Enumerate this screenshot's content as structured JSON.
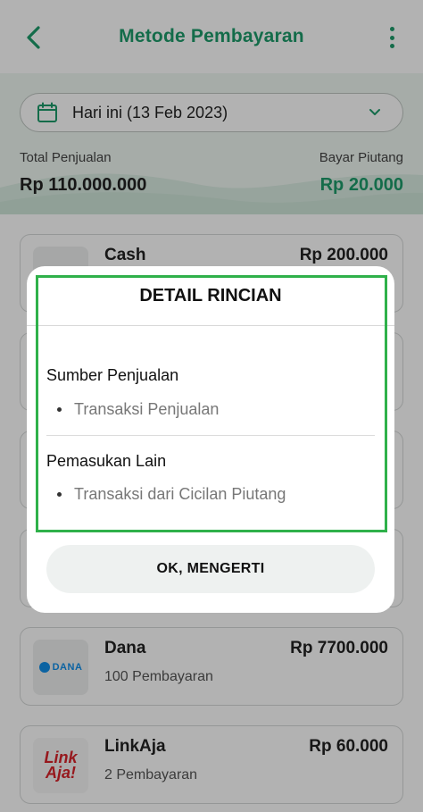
{
  "header": {
    "title": "Metode Pembayaran"
  },
  "summary": {
    "date_label": "Hari ini (13 Feb 2023)",
    "total_label": "Total Penjualan",
    "total_value": "Rp 110.000.000",
    "paid_label": "Bayar Piutang",
    "paid_value": "Rp 20.000"
  },
  "methods": [
    {
      "name": "Cash",
      "amount": "Rp 200.000",
      "count": ""
    },
    {
      "name": "Dana",
      "amount": "Rp 7700.000",
      "count": "100 Pembayaran",
      "logo_text": "DANA"
    },
    {
      "name": "LinkAja",
      "amount": "Rp 60.000",
      "count": "2 Pembayaran",
      "logo_text_1": "Link",
      "logo_text_2": "Aja!"
    }
  ],
  "modal": {
    "title": "DETAIL RINCIAN",
    "sections": [
      {
        "title": "Sumber Penjualan",
        "items": [
          "Transaksi Penjualan"
        ]
      },
      {
        "title": "Pemasukan Lain",
        "items": [
          "Transaksi dari Cicilan Piutang"
        ]
      }
    ],
    "ok_label": "OK, MENGERTI"
  },
  "colors": {
    "brand_green": "#1e9b6b",
    "highlight": "#2fb14a",
    "linkaja_red": "#d8232a",
    "dana_blue": "#118ee9"
  },
  "icons": [
    "back-arrow-icon",
    "more-vertical-icon",
    "calendar-icon",
    "chevron-down-icon",
    "dana-logo",
    "linkaja-logo"
  ]
}
